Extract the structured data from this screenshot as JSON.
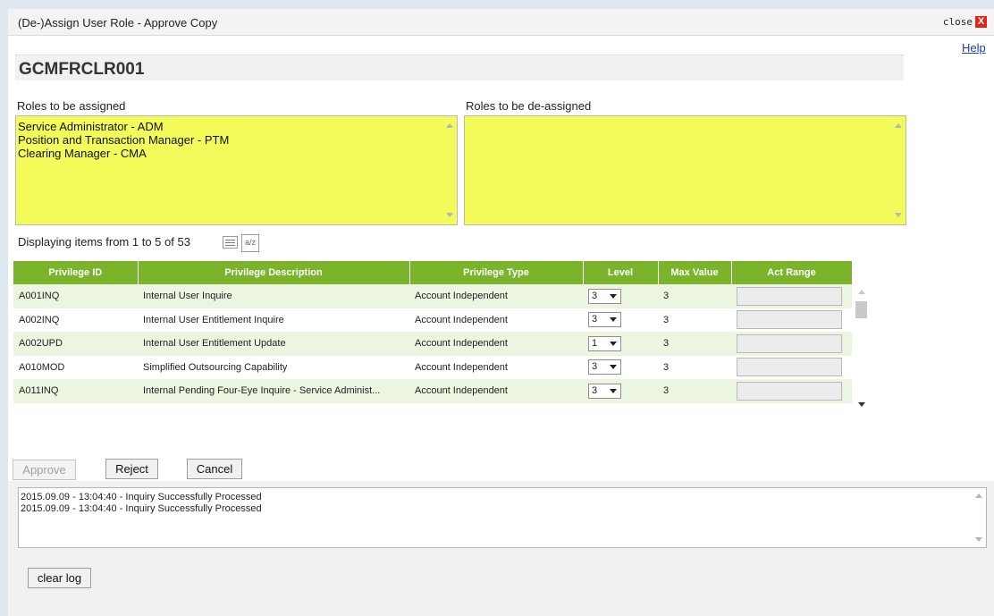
{
  "window": {
    "title": "(De-)Assign User Role - Approve Copy",
    "close_label": "close",
    "close_glyph": "X"
  },
  "help_label": "Help",
  "page_title": "GCMFRCLR001",
  "roles": {
    "assigned_label": "Roles to be assigned",
    "deassigned_label": "Roles to be de-assigned",
    "assigned_items": [
      "Service Administrator - ADM",
      "Position and Transaction Manager - PTM",
      "Clearing Manager - CMA"
    ],
    "deassigned_items": [],
    "box_color": "#f2fb59"
  },
  "pagination": {
    "info": "Displaying items from 1 to 5 of 53",
    "sort_icon_text": "a/z"
  },
  "grid": {
    "header_color": "#7bb42b",
    "columns": [
      "Privilege ID",
      "Privilege Description",
      "Privilege Type",
      "Level",
      "Max Value",
      "Act Range"
    ],
    "rows": [
      {
        "id": "A001INQ",
        "description": "Internal User Inquire",
        "type": "Account Independent",
        "level": "3",
        "max_value": "3"
      },
      {
        "id": "A002INQ",
        "description": "Internal User Entitlement Inquire",
        "type": "Account Independent",
        "level": "3",
        "max_value": "3"
      },
      {
        "id": "A002UPD",
        "description": "Internal User Entitlement Update",
        "type": "Account Independent",
        "level": "1",
        "max_value": "3"
      },
      {
        "id": "A010MOD",
        "description": "Simplified Outsourcing Capability",
        "type": "Account Independent",
        "level": "3",
        "max_value": "3"
      },
      {
        "id": "A011INQ",
        "description": "Internal Pending Four-Eye Inquire - Service Administ...",
        "type": "Account Independent",
        "level": "3",
        "max_value": "3"
      }
    ]
  },
  "actions": {
    "approve": "Approve",
    "reject": "Reject",
    "cancel": "Cancel"
  },
  "log": {
    "lines": [
      "2015.09.09 - 13:04:40 - Inquiry Successfully Processed",
      "2015.09.09 - 13:04:40 - Inquiry Successfully Processed"
    ],
    "clear_label": "clear log"
  }
}
